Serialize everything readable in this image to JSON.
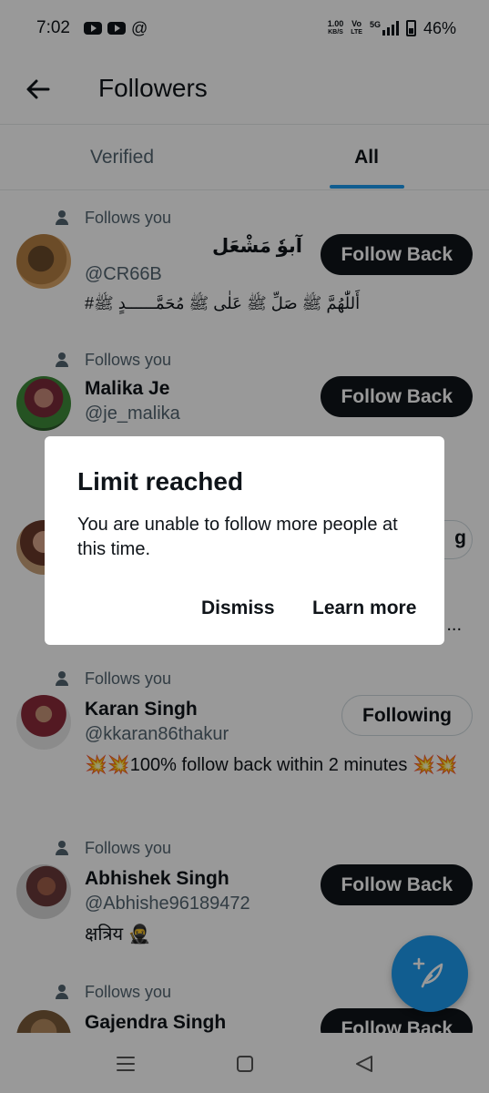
{
  "status_bar": {
    "time": "7:02",
    "speed_value": "1.00",
    "speed_unit": "KB/S",
    "volte_top": "Vo",
    "volte_bottom": "LTE",
    "network": "5G",
    "battery": "46%",
    "icons": [
      "youtube-icon",
      "youtube-icon",
      "at-icon",
      "signal-icon",
      "battery-icon"
    ]
  },
  "header": {
    "title": "Followers",
    "back_icon": "arrow-left-icon"
  },
  "tabs": [
    {
      "label": "Verified",
      "selected": false
    },
    {
      "label": "All",
      "selected": true
    }
  ],
  "followers": [
    {
      "follows_label": "Follows you",
      "name": "آبوٗ مَشْعَل",
      "handle": "@CR66B",
      "bio": "#أَللّٰھُمَّ ﷺ صَلِّ ﷺ عَلٰی ﷺ مُحَمَّــــــدٍ ﷺ",
      "button": "Follow Back"
    },
    {
      "follows_label": "Follows you",
      "name": "Malika Je",
      "handle": "@je_malika",
      "bio": "",
      "button": "Follow Back"
    },
    {
      "follows_label": "",
      "name": "",
      "handle": "",
      "bio": "...",
      "button": "g"
    },
    {
      "follows_label": "Follows you",
      "name": "Karan Singh",
      "handle": "@kkaran86thakur",
      "bio": "💥💥100% follow back within 2 minutes 💥💥",
      "button": "Following"
    },
    {
      "follows_label": "Follows you",
      "name": "Abhishek Singh",
      "handle": "@Abhishe96189472",
      "bio": "क्षत्रिय 🥷",
      "button": "Follow Back"
    },
    {
      "follows_label": "Follows you",
      "name": "Gajendra Singh",
      "handle": "",
      "bio": "",
      "button": "Follow Back"
    }
  ],
  "fab": {
    "icon": "compose-plus-icon"
  },
  "dialog": {
    "title": "Limit reached",
    "body": "You are unable to follow more people at this time.",
    "dismiss": "Dismiss",
    "learn_more": "Learn more"
  },
  "nav": {
    "icons": [
      "recents-icon",
      "home-icon",
      "back-icon"
    ]
  },
  "colors": {
    "accent": "#1d9bf0",
    "text": "#0f1419",
    "secondary": "#536471",
    "button_dark": "#0f1419"
  }
}
